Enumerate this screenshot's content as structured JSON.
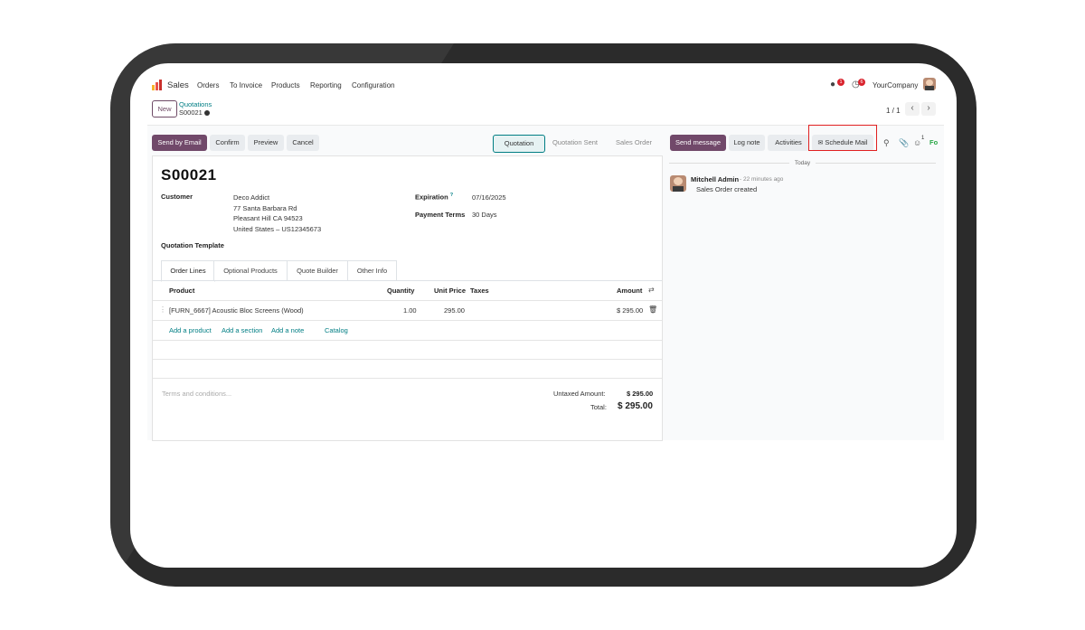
{
  "nav": {
    "app_name": "Sales",
    "items": [
      "Orders",
      "To Invoice",
      "Products",
      "Reporting",
      "Configuration"
    ],
    "company": "YourCompany",
    "chat_badge": "1",
    "activity_badge": "6"
  },
  "breadcrumb": {
    "new_label": "New",
    "parent": "Quotations",
    "current": "S00021"
  },
  "pager": {
    "text": "1 / 1"
  },
  "toolbar": {
    "send_by_email": "Send by Email",
    "confirm": "Confirm",
    "preview": "Preview",
    "cancel": "Cancel",
    "statuses": [
      "Quotation",
      "Quotation Sent",
      "Sales Order"
    ],
    "active_status": "Quotation"
  },
  "form": {
    "name": "S00021",
    "customer_label": "Customer",
    "customer_name": "Deco Addict",
    "address_line1": "77 Santa Barbara Rd",
    "address_line2": "Pleasant Hill CA 94523",
    "address_line3": "United States – US12345673",
    "expiration_label": "Expiration",
    "expiration_help": "?",
    "expiration_value": "07/16/2025",
    "payment_terms_label": "Payment Terms",
    "payment_terms_value": "30 Days",
    "template_label": "Quotation Template"
  },
  "tabs": [
    "Order Lines",
    "Optional Products",
    "Quote Builder",
    "Other Info"
  ],
  "order_lines": {
    "columns": [
      "Product",
      "Quantity",
      "Unit Price",
      "Taxes",
      "Amount"
    ],
    "rows": [
      {
        "product": "[FURN_6667] Acoustic Bloc Screens (Wood)",
        "quantity": "1.00",
        "unit_price": "295.00",
        "taxes": "",
        "amount": "$ 295.00"
      }
    ],
    "add_product": "Add a product",
    "add_section": "Add a section",
    "add_note": "Add a note",
    "catalog": "Catalog"
  },
  "totals": {
    "terms_placeholder": "Terms and conditions...",
    "untaxed_label": "Untaxed Amount:",
    "untaxed_value": "$ 295.00",
    "total_label": "Total:",
    "total_value": "$ 295.00"
  },
  "chatter": {
    "send_message": "Send message",
    "log_note": "Log note",
    "activities": "Activities",
    "schedule_mail": "Schedule Mail",
    "followers_count": "1",
    "follow_label": "Fo",
    "date_separator": "Today",
    "messages": [
      {
        "author": "Mitchell Admin",
        "time": "- 22 minutes ago",
        "body": "Sales Order created"
      }
    ]
  },
  "colors": {
    "primary": "#71496a",
    "link": "#017e84",
    "highlight": "#e02020",
    "bezel": "#2b2b2b"
  }
}
